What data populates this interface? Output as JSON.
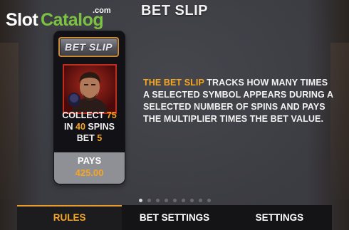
{
  "watermark": {
    "slot": "Slot",
    "catalog": "Catalog",
    "com": ".com"
  },
  "header": {
    "title": "BET SLIP"
  },
  "card": {
    "badge_label": "BET SLIP",
    "collect_word": "COLLECT",
    "collect_count": "75",
    "in_word": "IN",
    "spins_count": "40",
    "spins_word": "SPINS",
    "bet_word": "BET",
    "bet_value": "5",
    "pays_label": "PAYS",
    "pays_value": "425.00"
  },
  "description": {
    "highlight": "THE BET SLIP",
    "text": " TRACKS HOW MANY TIMES A SELECTED SYMBOL APPEARS DURING A SELECTED NUMBER OF SPINS AND PAYS THE MULTIPLIER TIMES THE BET VALUE."
  },
  "pagination": {
    "total": 9,
    "active_index": 0
  },
  "tabs": [
    {
      "label": "RULES",
      "active": true
    },
    {
      "label": "BET SETTINGS",
      "active": false
    },
    {
      "label": "SETTINGS",
      "active": false
    }
  ],
  "colors": {
    "accent": "#f5a623",
    "tab_active_line": "#e89a2a",
    "logo_green": "#7cc242"
  }
}
